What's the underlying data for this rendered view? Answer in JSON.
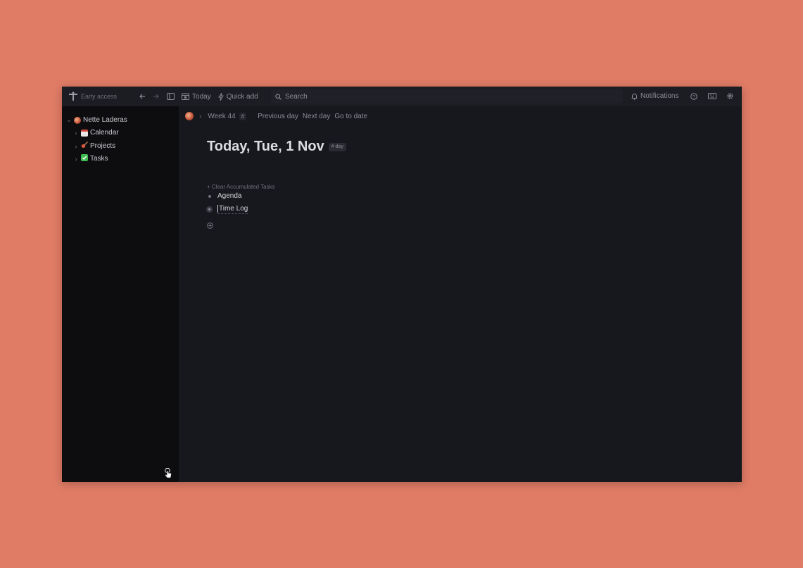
{
  "colors": {
    "background": "#E07C66",
    "window_bg": "#17181d",
    "topbar_bg": "#1c1d23",
    "sidebar_bg": "#0d0d10",
    "text_primary": "#dcdde3",
    "text_muted": "#8b8d96"
  },
  "topbar": {
    "brand_label": "Early access",
    "today_label": "Today",
    "quick_add_label": "Quick add",
    "search_placeholder": "Search",
    "notifications_label": "Notifications",
    "icons": [
      "logo-icon",
      "back-arrow-icon",
      "forward-arrow-icon",
      "sidebar-toggle-icon",
      "calendar-icon",
      "bolt-icon",
      "search-icon",
      "bell-icon",
      "help-icon",
      "keyboard-icon",
      "gear-icon"
    ]
  },
  "sidebar": {
    "workspace_label": "Nette Laderas",
    "items": [
      {
        "label": "Calendar",
        "icon": "calendar-emoji-icon"
      },
      {
        "label": "Projects",
        "icon": "guitar-emoji-icon"
      },
      {
        "label": "Tasks",
        "icon": "checkmark-emoji-icon"
      }
    ]
  },
  "breadcrumb": {
    "week_label": "Week 44",
    "hash_label": "#",
    "previous_day_label": "Previous day",
    "next_day_label": "Next day",
    "go_to_date_label": "Go to date"
  },
  "page": {
    "title": "Today, Tue, 1 Nov",
    "tag_label": "# day",
    "clear_label": "+ Clear Accumulated Tasks",
    "blocks": [
      {
        "label": "Agenda"
      },
      {
        "label": "Time Log"
      }
    ]
  }
}
